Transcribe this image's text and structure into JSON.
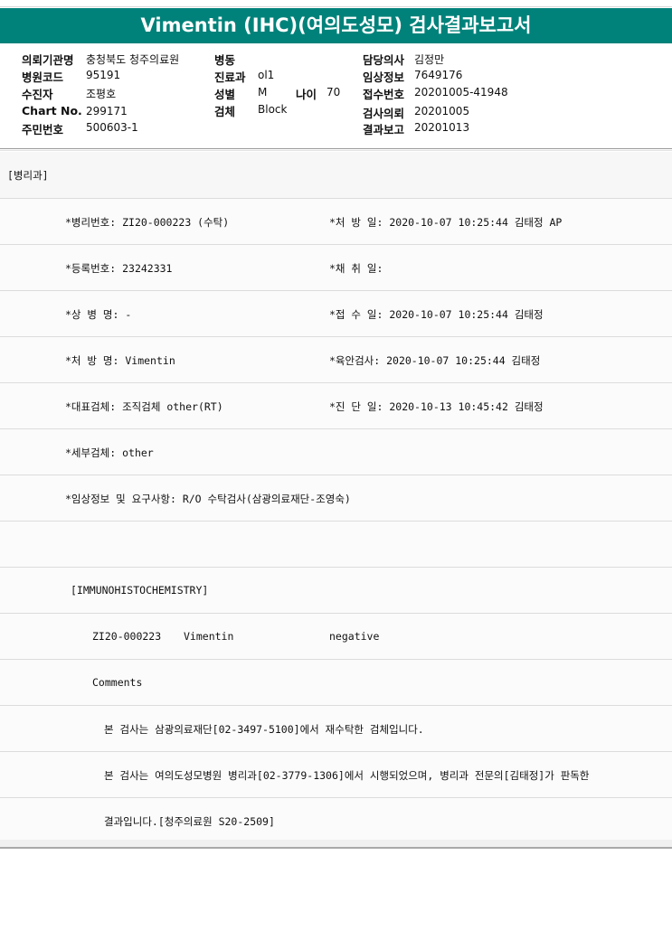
{
  "title": "Vimentin (IHC)(여의도성모) 검사결과보고서",
  "header": {
    "institution_label": "의뢰기관명",
    "institution": "충청북도 청주의료원",
    "hospital_code_label": "병원코드",
    "hospital_code": "95191",
    "patient_label": "수진자",
    "patient": "조평호",
    "chart_label": "Chart No.",
    "chart_no": "299171",
    "resident_label": "주민번호",
    "resident_no": "500603-1",
    "ward_label": "병동",
    "ward": "",
    "dept_label": "진료과",
    "dept": "ol1",
    "sex_label": "성별",
    "sex": "M",
    "age_label": "나이",
    "age": "70",
    "specimen_label": "검체",
    "specimen": "Block",
    "doctor_label": "담당의사",
    "doctor": "김정만",
    "clinical_label": "임상정보",
    "clinical": "7649176",
    "receipt_label": "접수번호",
    "receipt_no": "20201005-41948",
    "request_label": "검사의뢰",
    "request_date": "20201005",
    "report_label": "결과보고",
    "report_date": "20201013"
  },
  "report": {
    "department": "[병리과]",
    "path_no": "*병리번호: ZI20-000223 (수탁)",
    "order_date": "*처 방 일: 2020-10-07 10:25:44  김태정 AP",
    "reg_no": "*등록번호: 23242331",
    "collect_date": "*채 취 일:",
    "diagnosis": "*상 병 명: -",
    "receipt_date": "*접 수 일: 2020-10-07 10:25:44  김태정",
    "order_name": "*처 방 명: Vimentin",
    "gross_exam": "*육안검사: 2020-10-07 10:25:44  김태정",
    "main_specimen": "*대표검체: 조직검체 other(RT)",
    "diag_date": "*진 단 일: 2020-10-13 10:45:42  김태정",
    "sub_specimen": "*세부검체: other",
    "clinical_request": "*임상정보 및 요구사항: R/O 수탁검사(삼광의료재단-조영숙)",
    "section": "[IMMUNOHISTOCHEMISTRY]",
    "result_id": "ZI20-000223",
    "result_marker": "Vimentin",
    "result_value": "negative",
    "comments_label": "Comments",
    "comment1": "본 검사는 삼광의료재단[02-3497-5100]에서 재수탁한 검체입니다.",
    "comment2": "본 검사는 여의도성모병원 병리과[02-3779-1306]에서 시행되었으며, 병리과 전문의[김태정]가 판독한",
    "comment3": "결과입니다.[청주의료원 S20-2509]"
  }
}
